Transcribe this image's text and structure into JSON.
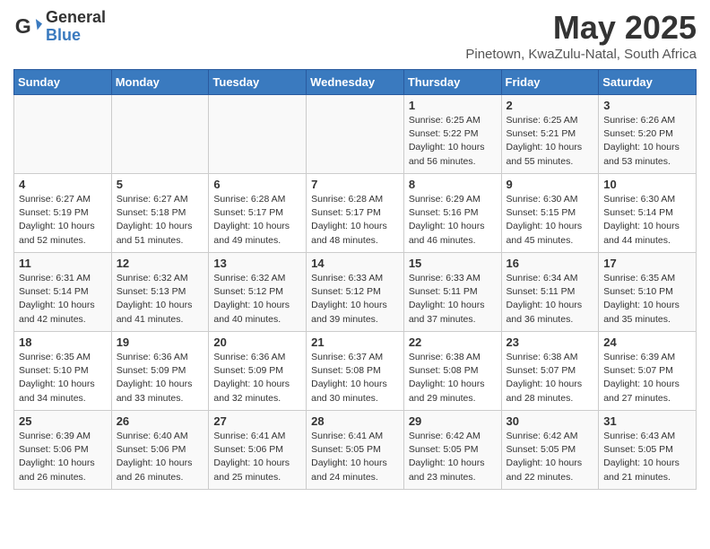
{
  "logo": {
    "general": "General",
    "blue": "Blue"
  },
  "title": "May 2025",
  "location": "Pinetown, KwaZulu-Natal, South Africa",
  "days_of_week": [
    "Sunday",
    "Monday",
    "Tuesday",
    "Wednesday",
    "Thursday",
    "Friday",
    "Saturday"
  ],
  "weeks": [
    [
      {
        "day": "",
        "info": ""
      },
      {
        "day": "",
        "info": ""
      },
      {
        "day": "",
        "info": ""
      },
      {
        "day": "",
        "info": ""
      },
      {
        "day": "1",
        "info": "Sunrise: 6:25 AM\nSunset: 5:22 PM\nDaylight: 10 hours\nand 56 minutes."
      },
      {
        "day": "2",
        "info": "Sunrise: 6:25 AM\nSunset: 5:21 PM\nDaylight: 10 hours\nand 55 minutes."
      },
      {
        "day": "3",
        "info": "Sunrise: 6:26 AM\nSunset: 5:20 PM\nDaylight: 10 hours\nand 53 minutes."
      }
    ],
    [
      {
        "day": "4",
        "info": "Sunrise: 6:27 AM\nSunset: 5:19 PM\nDaylight: 10 hours\nand 52 minutes."
      },
      {
        "day": "5",
        "info": "Sunrise: 6:27 AM\nSunset: 5:18 PM\nDaylight: 10 hours\nand 51 minutes."
      },
      {
        "day": "6",
        "info": "Sunrise: 6:28 AM\nSunset: 5:17 PM\nDaylight: 10 hours\nand 49 minutes."
      },
      {
        "day": "7",
        "info": "Sunrise: 6:28 AM\nSunset: 5:17 PM\nDaylight: 10 hours\nand 48 minutes."
      },
      {
        "day": "8",
        "info": "Sunrise: 6:29 AM\nSunset: 5:16 PM\nDaylight: 10 hours\nand 46 minutes."
      },
      {
        "day": "9",
        "info": "Sunrise: 6:30 AM\nSunset: 5:15 PM\nDaylight: 10 hours\nand 45 minutes."
      },
      {
        "day": "10",
        "info": "Sunrise: 6:30 AM\nSunset: 5:14 PM\nDaylight: 10 hours\nand 44 minutes."
      }
    ],
    [
      {
        "day": "11",
        "info": "Sunrise: 6:31 AM\nSunset: 5:14 PM\nDaylight: 10 hours\nand 42 minutes."
      },
      {
        "day": "12",
        "info": "Sunrise: 6:32 AM\nSunset: 5:13 PM\nDaylight: 10 hours\nand 41 minutes."
      },
      {
        "day": "13",
        "info": "Sunrise: 6:32 AM\nSunset: 5:12 PM\nDaylight: 10 hours\nand 40 minutes."
      },
      {
        "day": "14",
        "info": "Sunrise: 6:33 AM\nSunset: 5:12 PM\nDaylight: 10 hours\nand 39 minutes."
      },
      {
        "day": "15",
        "info": "Sunrise: 6:33 AM\nSunset: 5:11 PM\nDaylight: 10 hours\nand 37 minutes."
      },
      {
        "day": "16",
        "info": "Sunrise: 6:34 AM\nSunset: 5:11 PM\nDaylight: 10 hours\nand 36 minutes."
      },
      {
        "day": "17",
        "info": "Sunrise: 6:35 AM\nSunset: 5:10 PM\nDaylight: 10 hours\nand 35 minutes."
      }
    ],
    [
      {
        "day": "18",
        "info": "Sunrise: 6:35 AM\nSunset: 5:10 PM\nDaylight: 10 hours\nand 34 minutes."
      },
      {
        "day": "19",
        "info": "Sunrise: 6:36 AM\nSunset: 5:09 PM\nDaylight: 10 hours\nand 33 minutes."
      },
      {
        "day": "20",
        "info": "Sunrise: 6:36 AM\nSunset: 5:09 PM\nDaylight: 10 hours\nand 32 minutes."
      },
      {
        "day": "21",
        "info": "Sunrise: 6:37 AM\nSunset: 5:08 PM\nDaylight: 10 hours\nand 30 minutes."
      },
      {
        "day": "22",
        "info": "Sunrise: 6:38 AM\nSunset: 5:08 PM\nDaylight: 10 hours\nand 29 minutes."
      },
      {
        "day": "23",
        "info": "Sunrise: 6:38 AM\nSunset: 5:07 PM\nDaylight: 10 hours\nand 28 minutes."
      },
      {
        "day": "24",
        "info": "Sunrise: 6:39 AM\nSunset: 5:07 PM\nDaylight: 10 hours\nand 27 minutes."
      }
    ],
    [
      {
        "day": "25",
        "info": "Sunrise: 6:39 AM\nSunset: 5:06 PM\nDaylight: 10 hours\nand 26 minutes."
      },
      {
        "day": "26",
        "info": "Sunrise: 6:40 AM\nSunset: 5:06 PM\nDaylight: 10 hours\nand 26 minutes."
      },
      {
        "day": "27",
        "info": "Sunrise: 6:41 AM\nSunset: 5:06 PM\nDaylight: 10 hours\nand 25 minutes."
      },
      {
        "day": "28",
        "info": "Sunrise: 6:41 AM\nSunset: 5:05 PM\nDaylight: 10 hours\nand 24 minutes."
      },
      {
        "day": "29",
        "info": "Sunrise: 6:42 AM\nSunset: 5:05 PM\nDaylight: 10 hours\nand 23 minutes."
      },
      {
        "day": "30",
        "info": "Sunrise: 6:42 AM\nSunset: 5:05 PM\nDaylight: 10 hours\nand 22 minutes."
      },
      {
        "day": "31",
        "info": "Sunrise: 6:43 AM\nSunset: 5:05 PM\nDaylight: 10 hours\nand 21 minutes."
      }
    ]
  ]
}
